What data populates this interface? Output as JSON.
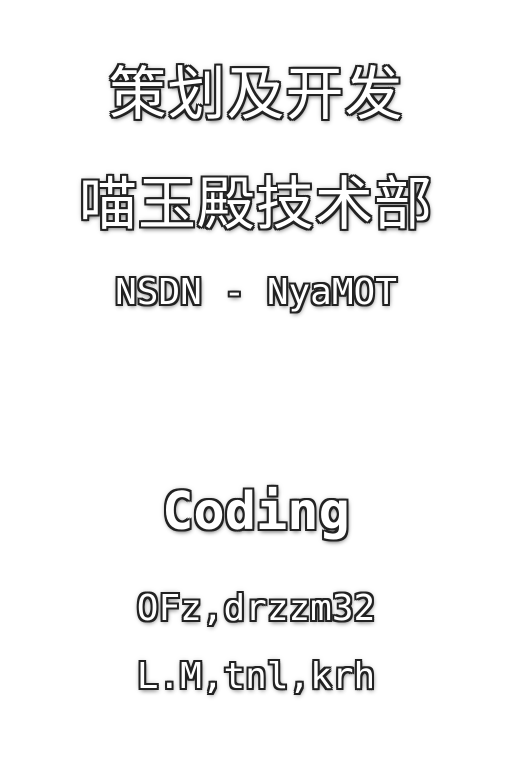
{
  "credits": {
    "role_title": "策划及开发",
    "team_name": "喵玉殿技术部",
    "team_tag": "NSDN - NyaMOT",
    "section_title": "Coding",
    "coders_line1": "OFz,drzzm32",
    "coders_line2": "L.M,tnl,krh"
  },
  "colors": {
    "background": "#ffffff",
    "text_fill": "#ffffff",
    "text_outline": "#222222"
  }
}
